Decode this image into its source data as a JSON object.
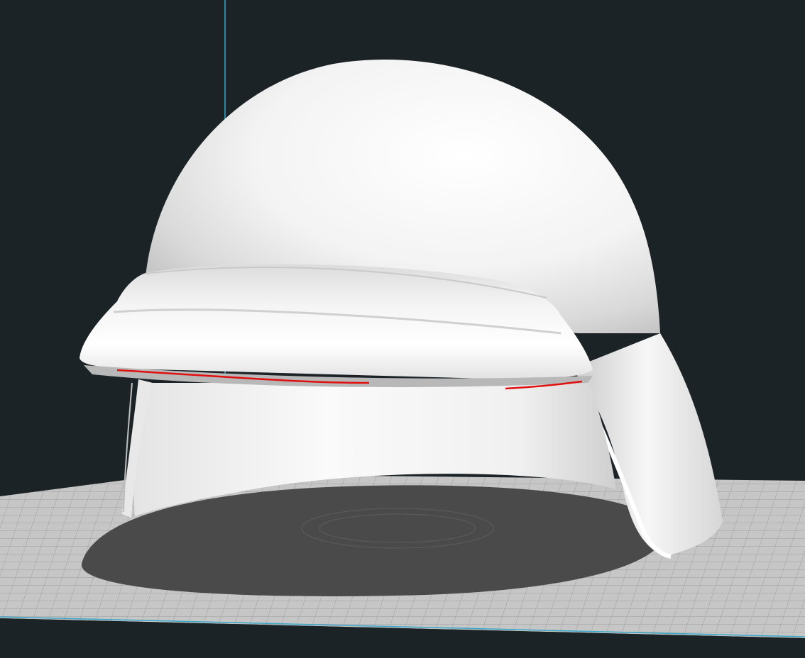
{
  "viewport": {
    "background_color": "#1c2326",
    "build_plate_color": "#c4c4c4",
    "grid_line_color": "#9a9a9a",
    "axis_color": "#3aa6c8",
    "model_color": "#f2f2f2",
    "overhang_highlight_color": "#e01010",
    "model_shadow_color": "#4a4a4a"
  },
  "model": {
    "type": "helmet",
    "selected": false
  }
}
